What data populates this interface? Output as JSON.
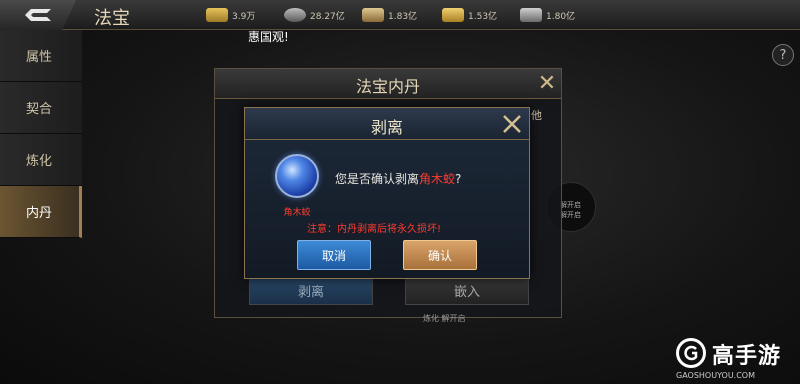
{
  "header": {
    "title": "法宝",
    "resources": [
      {
        "value": "3.9万",
        "color": "#c9a547"
      },
      {
        "value": "28.27亿",
        "color": "#8a8a8a"
      },
      {
        "value": "1.83亿",
        "color": "#b8985a"
      },
      {
        "value": "1.53亿",
        "color": "#c9a547"
      },
      {
        "value": "1.80亿",
        "color": "#9a9a9a"
      }
    ]
  },
  "top_text": "惠国观!",
  "sidebar": {
    "items": [
      {
        "label": "属性"
      },
      {
        "label": "契合"
      },
      {
        "label": "炼化"
      },
      {
        "label": "内丹"
      }
    ]
  },
  "outer_panel": {
    "title": "法宝内丹",
    "side_text": "他",
    "left_button": "剥离",
    "right_button": "嵌入",
    "bottom_text": "炼化 解开启"
  },
  "background": {
    "right_circle_text1": "解开启",
    "right_circle_text2": "解开启"
  },
  "dialog": {
    "title": "剥离",
    "item_name": "角木蛟",
    "confirm_prefix": "您是否确认剥离",
    "confirm_item": "角木蛟",
    "confirm_suffix": "?",
    "warning": "注意：内丹剥离后将永久损坏!",
    "cancel_label": "取消",
    "ok_label": "确认"
  },
  "watermark": {
    "text": "高手游",
    "sub": "GAOSHOUYOU.COM"
  }
}
